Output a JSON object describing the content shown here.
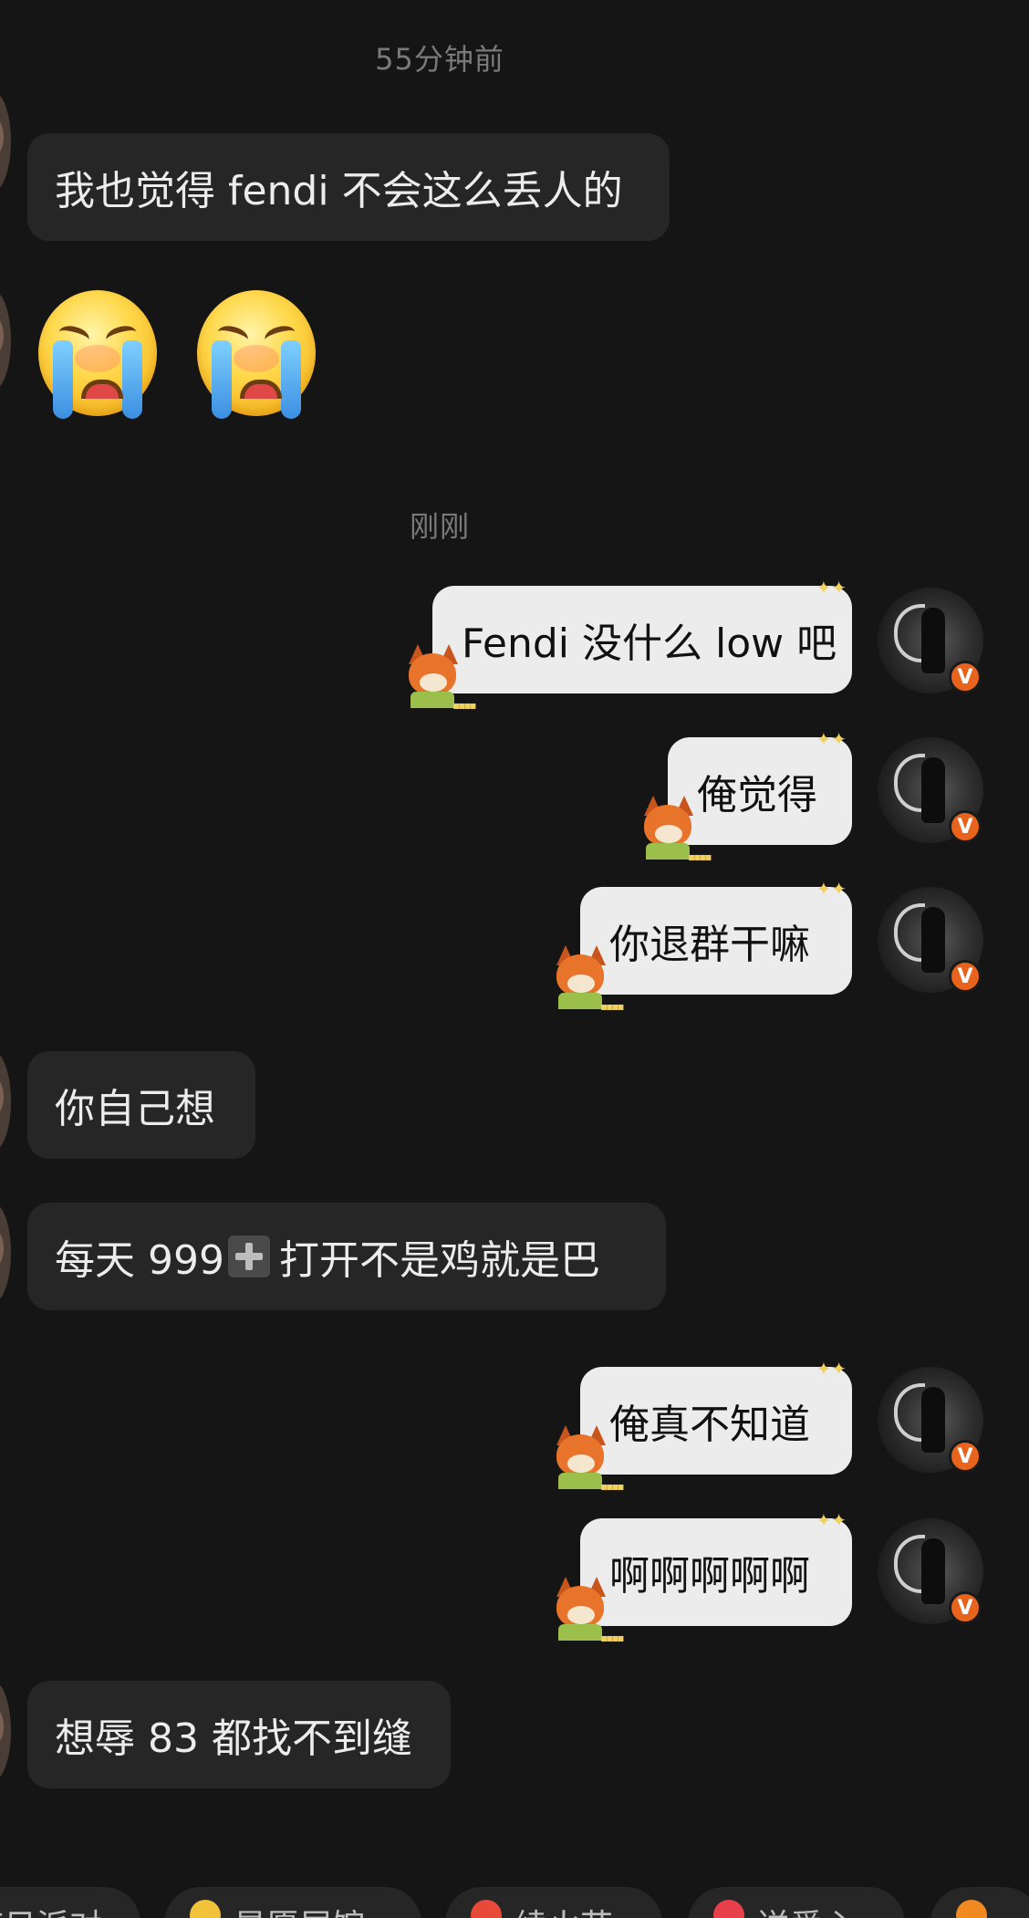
{
  "timestamps": {
    "t1": "55分钟前",
    "t2": "刚刚"
  },
  "messages": {
    "m1": "我也觉得 fendi 不会这么丢人的",
    "m3": "Fendi 没什么 low 吧",
    "m4": "俺觉得",
    "m5": "你退群干嘛",
    "m6": "你自己想",
    "m7_a": "每天 999",
    "m7_b": "打开不是鸡就是巴",
    "m8": "俺真不知道",
    "m9": "啊啊啊啊啊",
    "m10": "想辱 83 都找不到缝"
  },
  "avatar_badge": "V",
  "chips": [
    {
      "label": "节日派对"
    },
    {
      "label": "星愿展馆"
    },
    {
      "label": "续火花"
    },
    {
      "label": "送爱心"
    }
  ],
  "colors": {
    "background": "#151515",
    "incoming_bubble": "#262626",
    "outgoing_bubble": "#ececec",
    "badge": "#e8641c"
  }
}
